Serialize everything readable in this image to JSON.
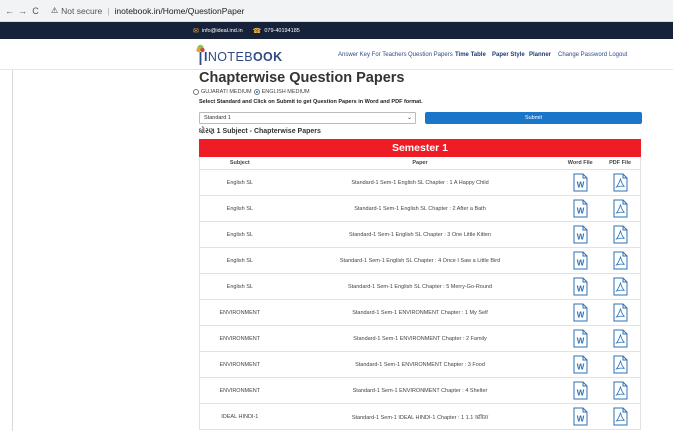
{
  "browser": {
    "back": "←",
    "forward": "→",
    "reload": "C",
    "warning_icon": "warning-icon",
    "security": "Not secure",
    "url": "inotebook.in/Home/QuestionPaper"
  },
  "contact": {
    "email": "info@ideal.ind.in",
    "phone": "079-40194185"
  },
  "logo": {
    "part1": "I",
    "part2": "NOTEB",
    "part3": "OOK"
  },
  "nav": {
    "items": [
      {
        "label": "Answer Key For Teachers",
        "bold": false
      },
      {
        "label": "Question Papers",
        "bold": false
      },
      {
        "label": "Time Table",
        "bold": true
      },
      {
        "label": "Paper Style",
        "bold": true
      },
      {
        "label": "Planner",
        "bold": true
      },
      {
        "label": "Change Password",
        "bold": false
      },
      {
        "label": "Logout",
        "bold": false
      }
    ]
  },
  "page": {
    "title": "Chapterwise Question Papers",
    "medium_gujarati": "GUJARATI MEDIUM",
    "medium_english": "ENGLISH MEDIUM",
    "selected_medium": "english",
    "instructions": "Select Standard and Click on Submit to get Question Papers in Word and PDF format.",
    "standard_value": "Standard 1",
    "submit_label": "Submit",
    "section_title": "ધોરણ 1 Subject - Chapterwise Papers",
    "semester": "Semester 1"
  },
  "table": {
    "headers": [
      "Subject",
      "Paper",
      "Word File",
      "PDF File"
    ],
    "rows": [
      {
        "subject": "English SL",
        "paper": "Standard-1 Sem-1 English SL Chapter : 1 A Happy Child"
      },
      {
        "subject": "English SL",
        "paper": "Standard-1 Sem-1 English SL Chapter : 2 After a Bath"
      },
      {
        "subject": "English SL",
        "paper": "Standard-1 Sem-1 English SL Chapter : 3 One Little Kitten"
      },
      {
        "subject": "English SL",
        "paper": "Standard-1 Sem-1 English SL Chapter : 4 Once I Saw a Little Bird"
      },
      {
        "subject": "English SL",
        "paper": "Standard-1 Sem-1 English SL Chapter : 5 Merry-Go-Round"
      },
      {
        "subject": "ENVIRONMENT",
        "paper": "Standard-1 Sem-1 ENVIRONMENT Chapter : 1 My Self"
      },
      {
        "subject": "ENVIRONMENT",
        "paper": "Standard-1 Sem-1 ENVIRONMENT Chapter : 2 Family"
      },
      {
        "subject": "ENVIRONMENT",
        "paper": "Standard-1 Sem-1 ENVIRONMENT Chapter : 3 Food"
      },
      {
        "subject": "ENVIRONMENT",
        "paper": "Standard-1 Sem-1 ENVIRONMENT Chapter : 4 Shelter"
      },
      {
        "subject": "IDEAL HINDI-1",
        "paper": "Standard-1 Sem-1 IDEAL HINDI-1 Chapter : 1 1.1 कविता"
      }
    ]
  },
  "colors": {
    "accent_blue": "#1a76c9",
    "semester_red": "#ee1c25",
    "dark_strip": "#16213a",
    "brand": "#2f4b86"
  }
}
